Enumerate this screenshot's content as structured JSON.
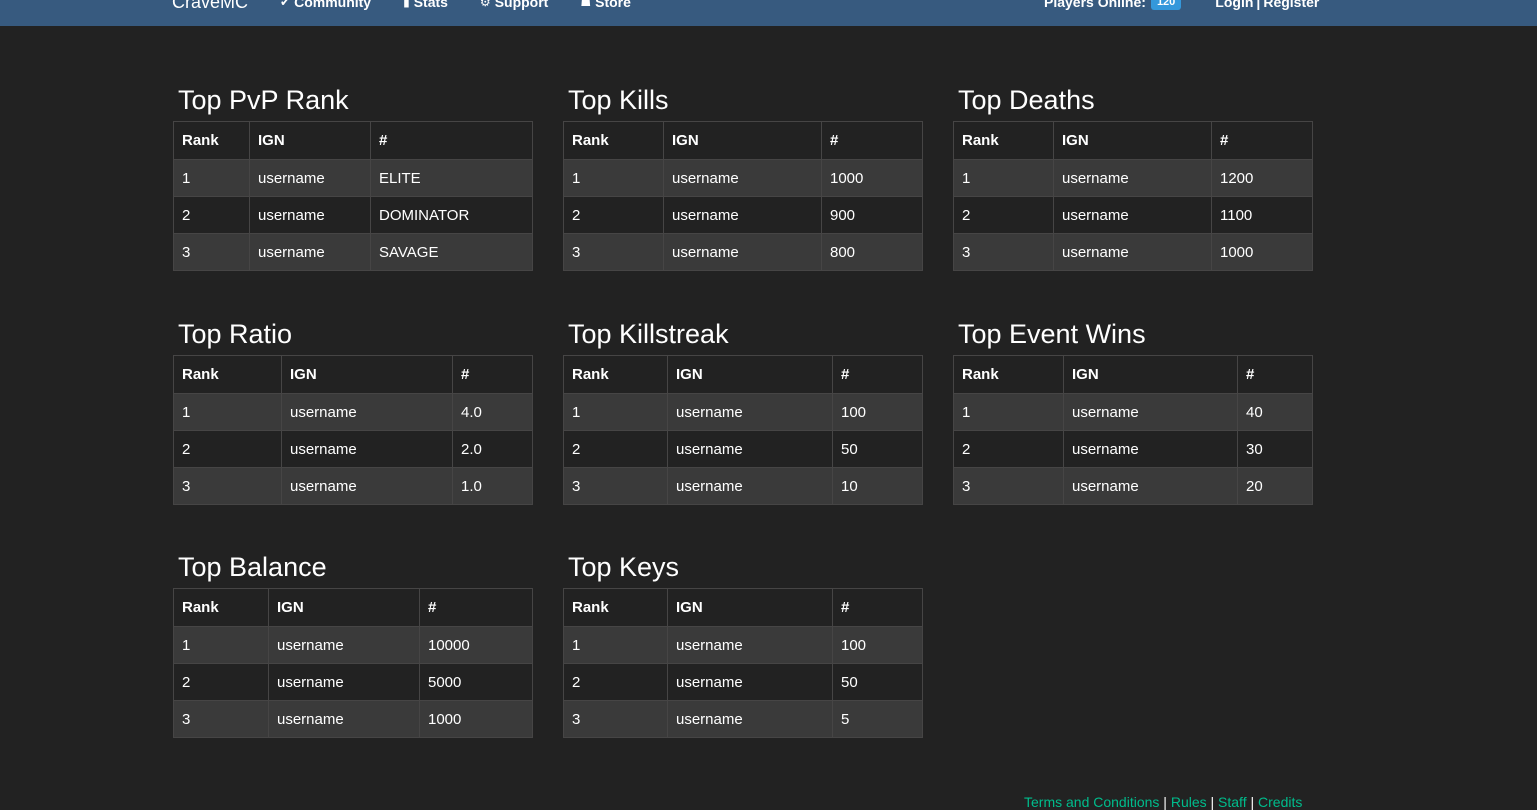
{
  "nav": {
    "brand": "CraveMC",
    "links": [
      {
        "icon": "✔",
        "label": "Community"
      },
      {
        "icon": "▮",
        "label": "Stats"
      },
      {
        "icon": "⚙",
        "label": "Support"
      },
      {
        "icon": "☗",
        "label": "Store"
      }
    ],
    "players_online_label": "Players Online:",
    "players_online_count": "120",
    "login_label": "Login",
    "auth_sep": "|",
    "register_label": "Register"
  },
  "headers": {
    "rank": "Rank",
    "ign": "IGN",
    "value": "#"
  },
  "boards": [
    {
      "title": "Top PvP Rank",
      "rows": [
        [
          "1",
          "username",
          "ELITE"
        ],
        [
          "2",
          "username",
          "DOMINATOR"
        ],
        [
          "3",
          "username",
          "SAVAGE"
        ]
      ]
    },
    {
      "title": "Top Kills",
      "rows": [
        [
          "1",
          "username",
          "1000"
        ],
        [
          "2",
          "username",
          "900"
        ],
        [
          "3",
          "username",
          "800"
        ]
      ]
    },
    {
      "title": "Top Deaths",
      "rows": [
        [
          "1",
          "username",
          "1200"
        ],
        [
          "2",
          "username",
          "1100"
        ],
        [
          "3",
          "username",
          "1000"
        ]
      ]
    },
    {
      "title": "Top Ratio",
      "rows": [
        [
          "1",
          "username",
          "4.0"
        ],
        [
          "2",
          "username",
          "2.0"
        ],
        [
          "3",
          "username",
          "1.0"
        ]
      ]
    },
    {
      "title": "Top Killstreak",
      "rows": [
        [
          "1",
          "username",
          "100"
        ],
        [
          "2",
          "username",
          "50"
        ],
        [
          "3",
          "username",
          "10"
        ]
      ]
    },
    {
      "title": "Top Event Wins",
      "rows": [
        [
          "1",
          "username",
          "40"
        ],
        [
          "2",
          "username",
          "30"
        ],
        [
          "3",
          "username",
          "20"
        ]
      ]
    },
    {
      "title": "Top Balance",
      "rows": [
        [
          "1",
          "username",
          "10000"
        ],
        [
          "2",
          "username",
          "5000"
        ],
        [
          "3",
          "username",
          "1000"
        ]
      ]
    },
    {
      "title": "Top Keys",
      "rows": [
        [
          "1",
          "username",
          "100"
        ],
        [
          "2",
          "username",
          "50"
        ],
        [
          "3",
          "username",
          "5"
        ]
      ]
    }
  ],
  "footer": {
    "links": [
      "Terms and Conditions",
      "Rules",
      "Staff",
      "Credits"
    ],
    "sep": "|"
  },
  "colors": {
    "navbar": "#375a7f",
    "background": "#222222",
    "row_alt": "#3a3a3a",
    "badge": "#3498db",
    "footer_link": "#00bc8c"
  }
}
